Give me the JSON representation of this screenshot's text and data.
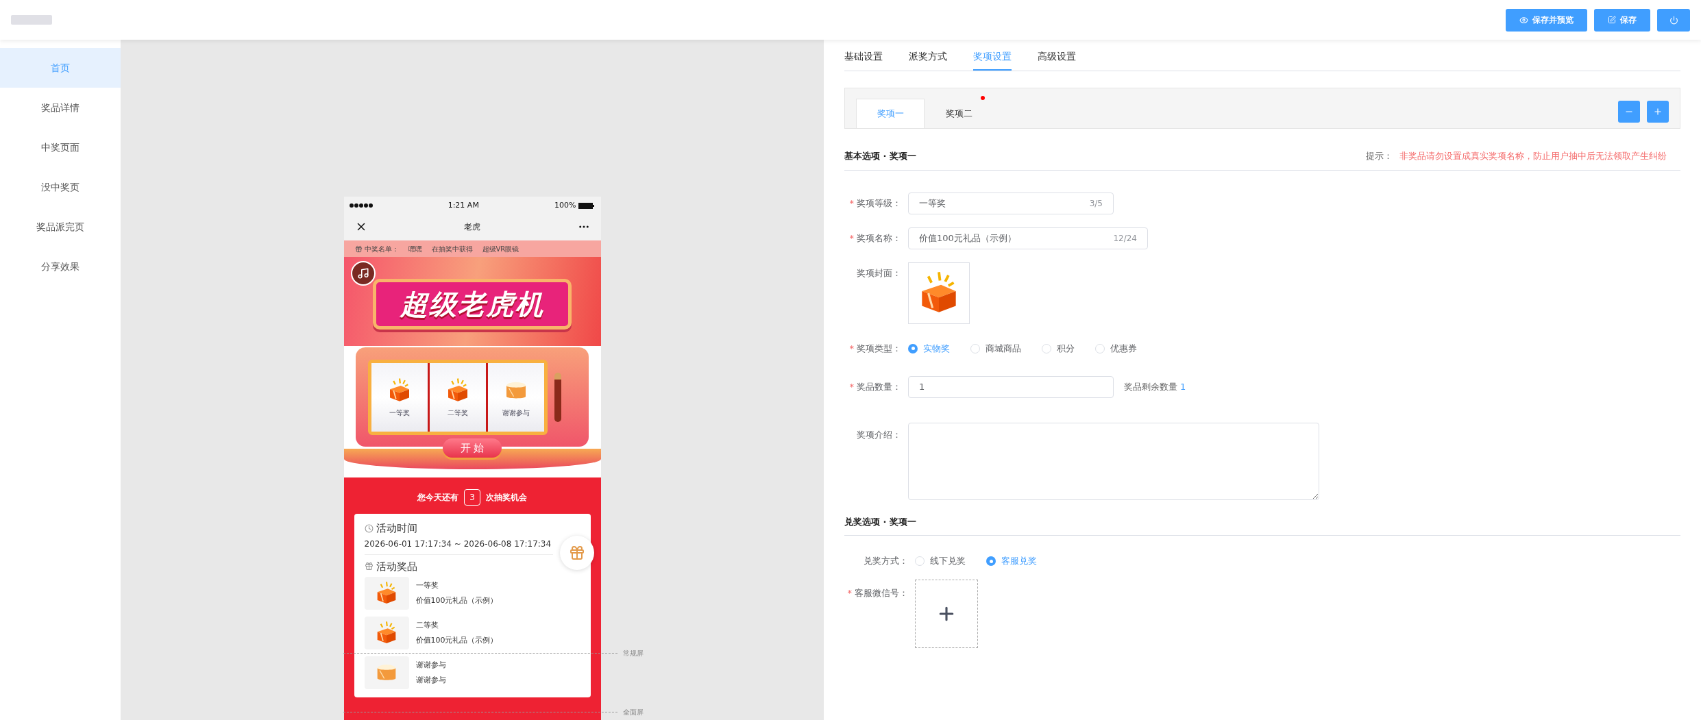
{
  "header": {
    "buttons": [
      {
        "kind": "preview",
        "label": "保存并预览"
      },
      {
        "kind": "save",
        "label": "保存"
      },
      {
        "kind": "power"
      }
    ]
  },
  "sidebar": {
    "items": [
      {
        "label": "首页",
        "selected": true
      },
      {
        "label": "奖品详情",
        "selected": false
      },
      {
        "label": "中奖页面",
        "selected": false
      },
      {
        "label": "没中奖页",
        "selected": false
      },
      {
        "label": "奖品派完页",
        "selected": false
      },
      {
        "label": "分享效果",
        "selected": false
      }
    ]
  },
  "phone": {
    "status_bar": {
      "time": "1:21 AM",
      "battery": "100%"
    },
    "nav_title": "老虎",
    "ticker": {
      "label": "中奖名单：",
      "entries": [
        "嘿嘿",
        "在抽奖中获得",
        "超级VR眼镜"
      ]
    },
    "banner_title": "超级老虎机",
    "reels": [
      {
        "label": "一等奖",
        "kind": "gift"
      },
      {
        "label": "二等奖",
        "kind": "gift"
      },
      {
        "label": "谢谢参与",
        "kind": "thanks"
      }
    ],
    "start_button": "开 始",
    "chances": {
      "before": "您今天还有",
      "count": "3",
      "after": "次抽奖机会"
    },
    "activity_time": {
      "heading": "活动时间",
      "range": "2026-06-01 17:17:34 ~ 2026-06-08 17:17:34"
    },
    "prizes": {
      "heading": "活动奖品",
      "items": [
        {
          "level": "一等奖",
          "name": "价值100元礼品（示例）",
          "kind": "gift"
        },
        {
          "level": "二等奖",
          "name": "价值100元礼品（示例）",
          "kind": "gift"
        },
        {
          "level": "谢谢参与",
          "name": "谢谢参与",
          "kind": "thanks"
        }
      ]
    }
  },
  "screen_guides": [
    {
      "label": "常规屏"
    },
    {
      "label": "全面屏"
    }
  ],
  "settings": {
    "tabs": [
      {
        "label": "基础设置",
        "selected": false
      },
      {
        "label": "派奖方式",
        "selected": false
      },
      {
        "label": "奖项设置",
        "selected": true
      },
      {
        "label": "高级设置",
        "selected": false
      }
    ],
    "prize_tabs": [
      {
        "label": "奖项一",
        "selected": true,
        "dot": false
      },
      {
        "label": "奖项二",
        "selected": false,
        "dot": true
      }
    ],
    "basic_section": {
      "title": "基本选项 · 奖项一",
      "hint_label": "提示：",
      "hint": "非奖品请勿设置成真实奖项名称，防止用户抽中后无法领取产生纠纷"
    },
    "prize_level": {
      "label": "奖项等级：",
      "required": true,
      "value": "一等奖",
      "counter": "3/5"
    },
    "prize_name": {
      "label": "奖项名称：",
      "required": true,
      "value": "价值100元礼品（示例）",
      "counter": "12/24"
    },
    "cover": {
      "label": "奖项封面：",
      "required": false
    },
    "prize_type": {
      "label": "奖项类型：",
      "required": true,
      "options": [
        {
          "label": "实物奖",
          "selected": true
        },
        {
          "label": "商城商品",
          "selected": false
        },
        {
          "label": "积分",
          "selected": false
        },
        {
          "label": "优惠券",
          "selected": false
        }
      ]
    },
    "quantity": {
      "label": "奖品数量：",
      "required": true,
      "value": "1",
      "remaining_label": "奖品剩余数量",
      "remaining_value": "1"
    },
    "description": {
      "label": "奖项介绍：",
      "required": false
    },
    "redeem_section": {
      "title": "兑奖选项 · 奖项一"
    },
    "redeem_method": {
      "label": "兑奖方式：",
      "required": false,
      "options": [
        {
          "label": "线下兑奖",
          "selected": false
        },
        {
          "label": "客服兑奖",
          "selected": true
        }
      ]
    },
    "wechat": {
      "label": "客服微信号：",
      "required": true
    },
    "required_mark": "*"
  }
}
